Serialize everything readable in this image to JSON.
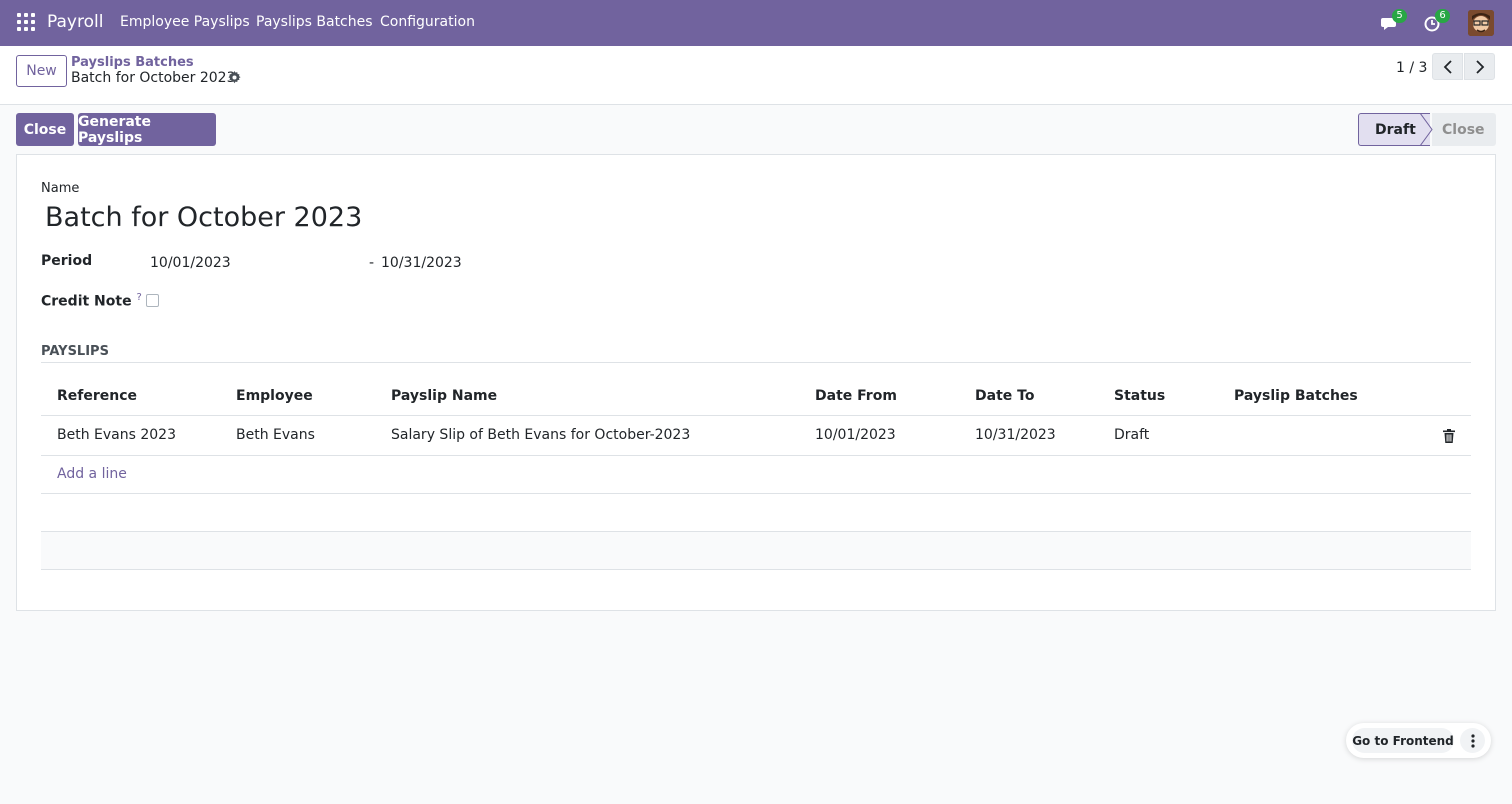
{
  "navbar": {
    "brand": "Payroll",
    "menu": [
      "Employee Payslips",
      "Payslips Batches",
      "Configuration"
    ],
    "messages_count": "5",
    "activities_count": "6"
  },
  "control_panel": {
    "new_label": "New",
    "breadcrumb_parent": "Payslips Batches",
    "breadcrumb_current": "Batch for October 2023",
    "pager": "1 / 3"
  },
  "statusbar": {
    "close_button": "Close",
    "generate_button": "Generate Payslips",
    "stages": [
      "Draft",
      "Close"
    ],
    "active_stage": "Draft"
  },
  "form": {
    "name_label": "Name",
    "name_value": "Batch for October 2023",
    "period_label": "Period",
    "period_from": "10/01/2023",
    "period_separator": "-",
    "period_to": "10/31/2023",
    "credit_note_label": "Credit Note",
    "credit_note_help": "?",
    "credit_note_checked": false,
    "payslips_section": "PAYSLIPS"
  },
  "payslips_table": {
    "columns": [
      "Reference",
      "Employee",
      "Payslip Name",
      "Date From",
      "Date To",
      "Status",
      "Payslip Batches"
    ],
    "rows": [
      [
        "Beth Evans 2023",
        "Beth Evans",
        "Salary Slip of Beth Evans for October-2023",
        "10/01/2023",
        "10/31/2023",
        "Draft",
        ""
      ]
    ],
    "add_line": "Add a line"
  },
  "floating": {
    "go_to_frontend": "Go to Frontend"
  },
  "colors": {
    "brand": "#71639e",
    "badge": "#28a745"
  }
}
